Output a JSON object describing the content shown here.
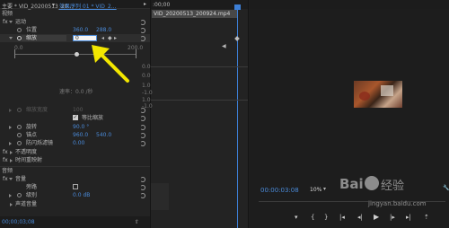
{
  "effect_controls": {
    "tab_title": "主要 * VID_20200513_20…",
    "tab_sequence": "效果序列 01 * VID_2…",
    "section_video": "视频",
    "motion": "运动",
    "position_label": "位置",
    "position_x": "360.0",
    "position_y": "288.0",
    "scale_label": "缩放",
    "scale_value": "0",
    "slider_min": "0.0",
    "slider_max": "200.0",
    "velocity_label": "速率：0.0 /秒",
    "scale_width_label": "缩放宽度",
    "scale_width_value": "100",
    "uniform_scale": "等比缩放",
    "rotation_label": "旋转",
    "rotation_value": "90.0 °",
    "anchor_label": "锚点",
    "anchor_x": "960.0",
    "anchor_y": "540.0",
    "antiflicker_label": "防闪烁滤镜",
    "antiflicker_value": "0.00",
    "opacity_label": "不透明度",
    "time_remap_label": "时间重映射",
    "section_audio": "音频",
    "volume_label": "音量",
    "bypass_label": "旁路",
    "level_label": "级别",
    "level_value": "0.0 dB",
    "channel_volume_label": "声道音量",
    "timecode": "00;00;03;08"
  },
  "mini_timeline": {
    "ruler_time": ":00;00",
    "clip_name": "VID_20200513_200924.mp4",
    "scale_marks": [
      "0.0",
      "0.0",
      "1.0",
      "-1.0",
      "1.0",
      "-1.0"
    ]
  },
  "program_monitor": {
    "timecode": "00:00:03:08",
    "zoom": "10%"
  },
  "watermark": {
    "site": "jingyan.baidu.com"
  },
  "colors": {
    "accent_blue": "#4a8ad8",
    "playhead": "#3d7fd6",
    "annotation_arrow": "#f2e600"
  }
}
